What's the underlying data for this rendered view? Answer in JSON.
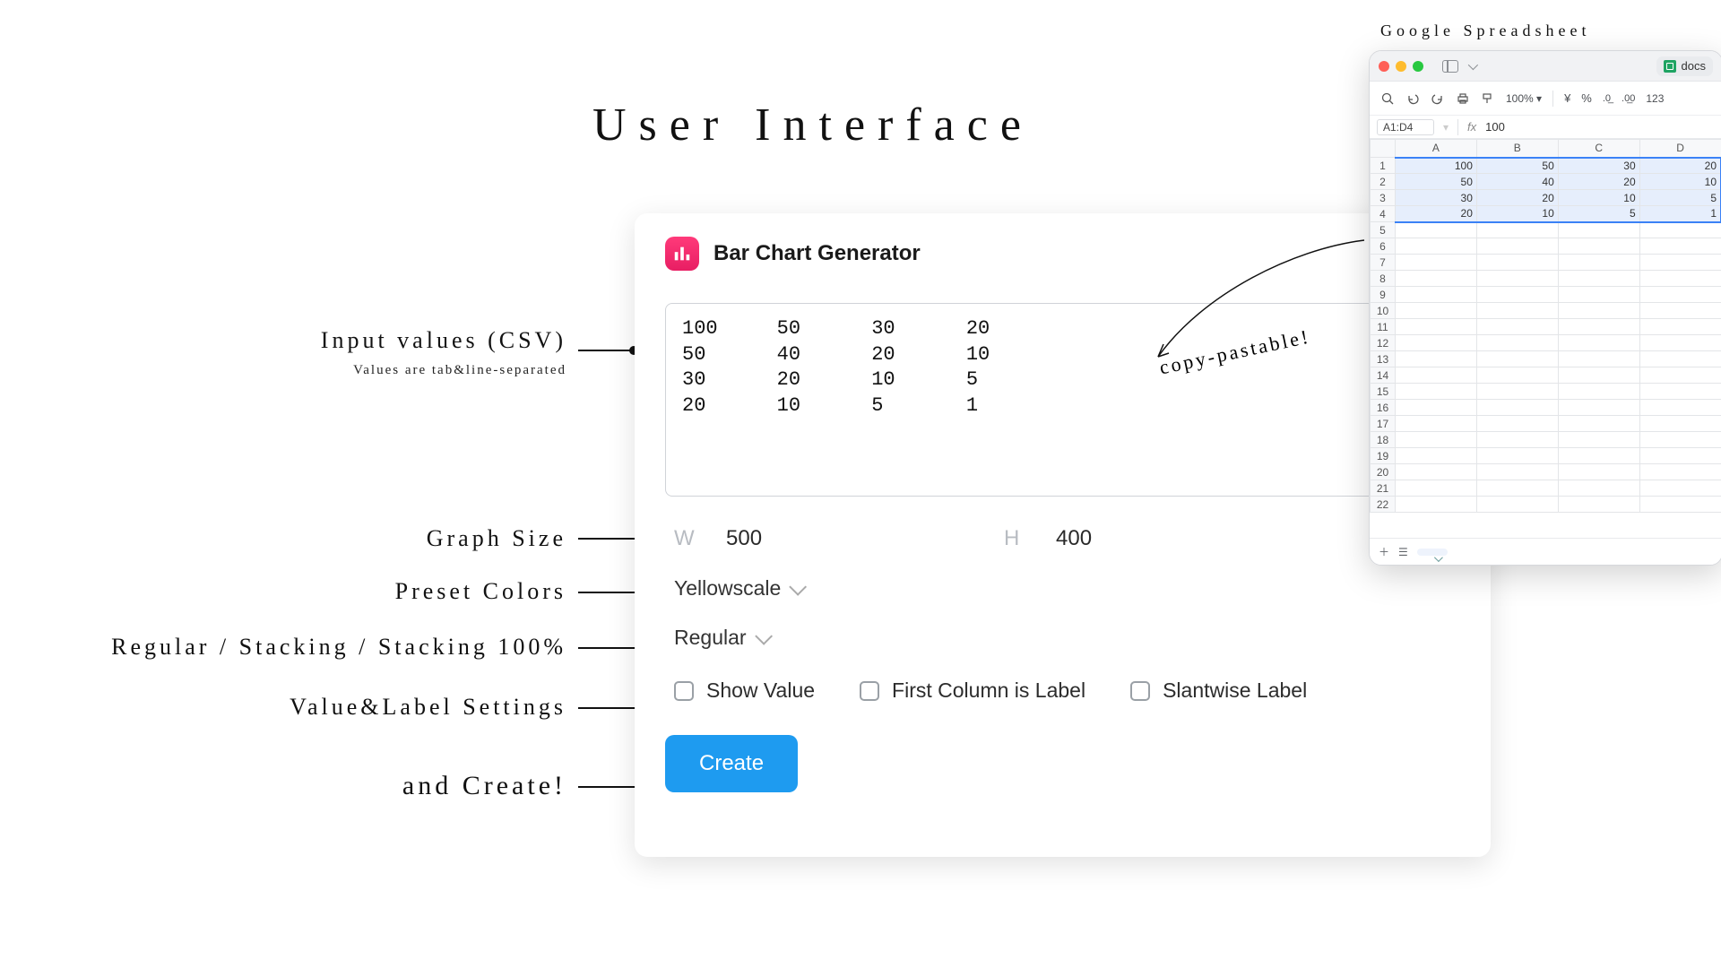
{
  "heading": "User Interface",
  "annotations": {
    "csv_title": "Input values (CSV)",
    "csv_sub": "Values are tab&line-separated",
    "size": "Graph Size",
    "colors": "Preset Colors",
    "stacking": "Regular / Stacking / Stacking 100%",
    "checks": "Value&Label Settings",
    "create": "and Create!"
  },
  "app": {
    "title": "Bar Chart Generator",
    "csv_value": "100\t50\t30\t20\n50\t40\t20\t10\n30\t20\t10\t5\n20\t10\t5\t1",
    "width_label": "W",
    "width_value": "500",
    "height_label": "H",
    "height_value": "400",
    "color_preset": "Yellowscale",
    "stack_mode": "Regular",
    "check_show_value": "Show Value",
    "check_first_col_label": "First Column is Label",
    "check_slant": "Slantwise Label",
    "create_button": "Create"
  },
  "copy_pastable": "copy-pastable!",
  "gs_label": "Google Spreadsheet",
  "gs": {
    "url_text": "docs",
    "zoom": "100%",
    "fmt123": "123",
    "cell_ref": "A1:D4",
    "fx_value": "100",
    "col_headers": [
      "A",
      "B",
      "C",
      "D"
    ],
    "rows": [
      [
        "100",
        "50",
        "30",
        "20"
      ],
      [
        "50",
        "40",
        "20",
        "10"
      ],
      [
        "30",
        "20",
        "10",
        "5"
      ],
      [
        "20",
        "10",
        "5",
        "1"
      ]
    ],
    "empty_rows": 18,
    "sheet_tab": " "
  }
}
